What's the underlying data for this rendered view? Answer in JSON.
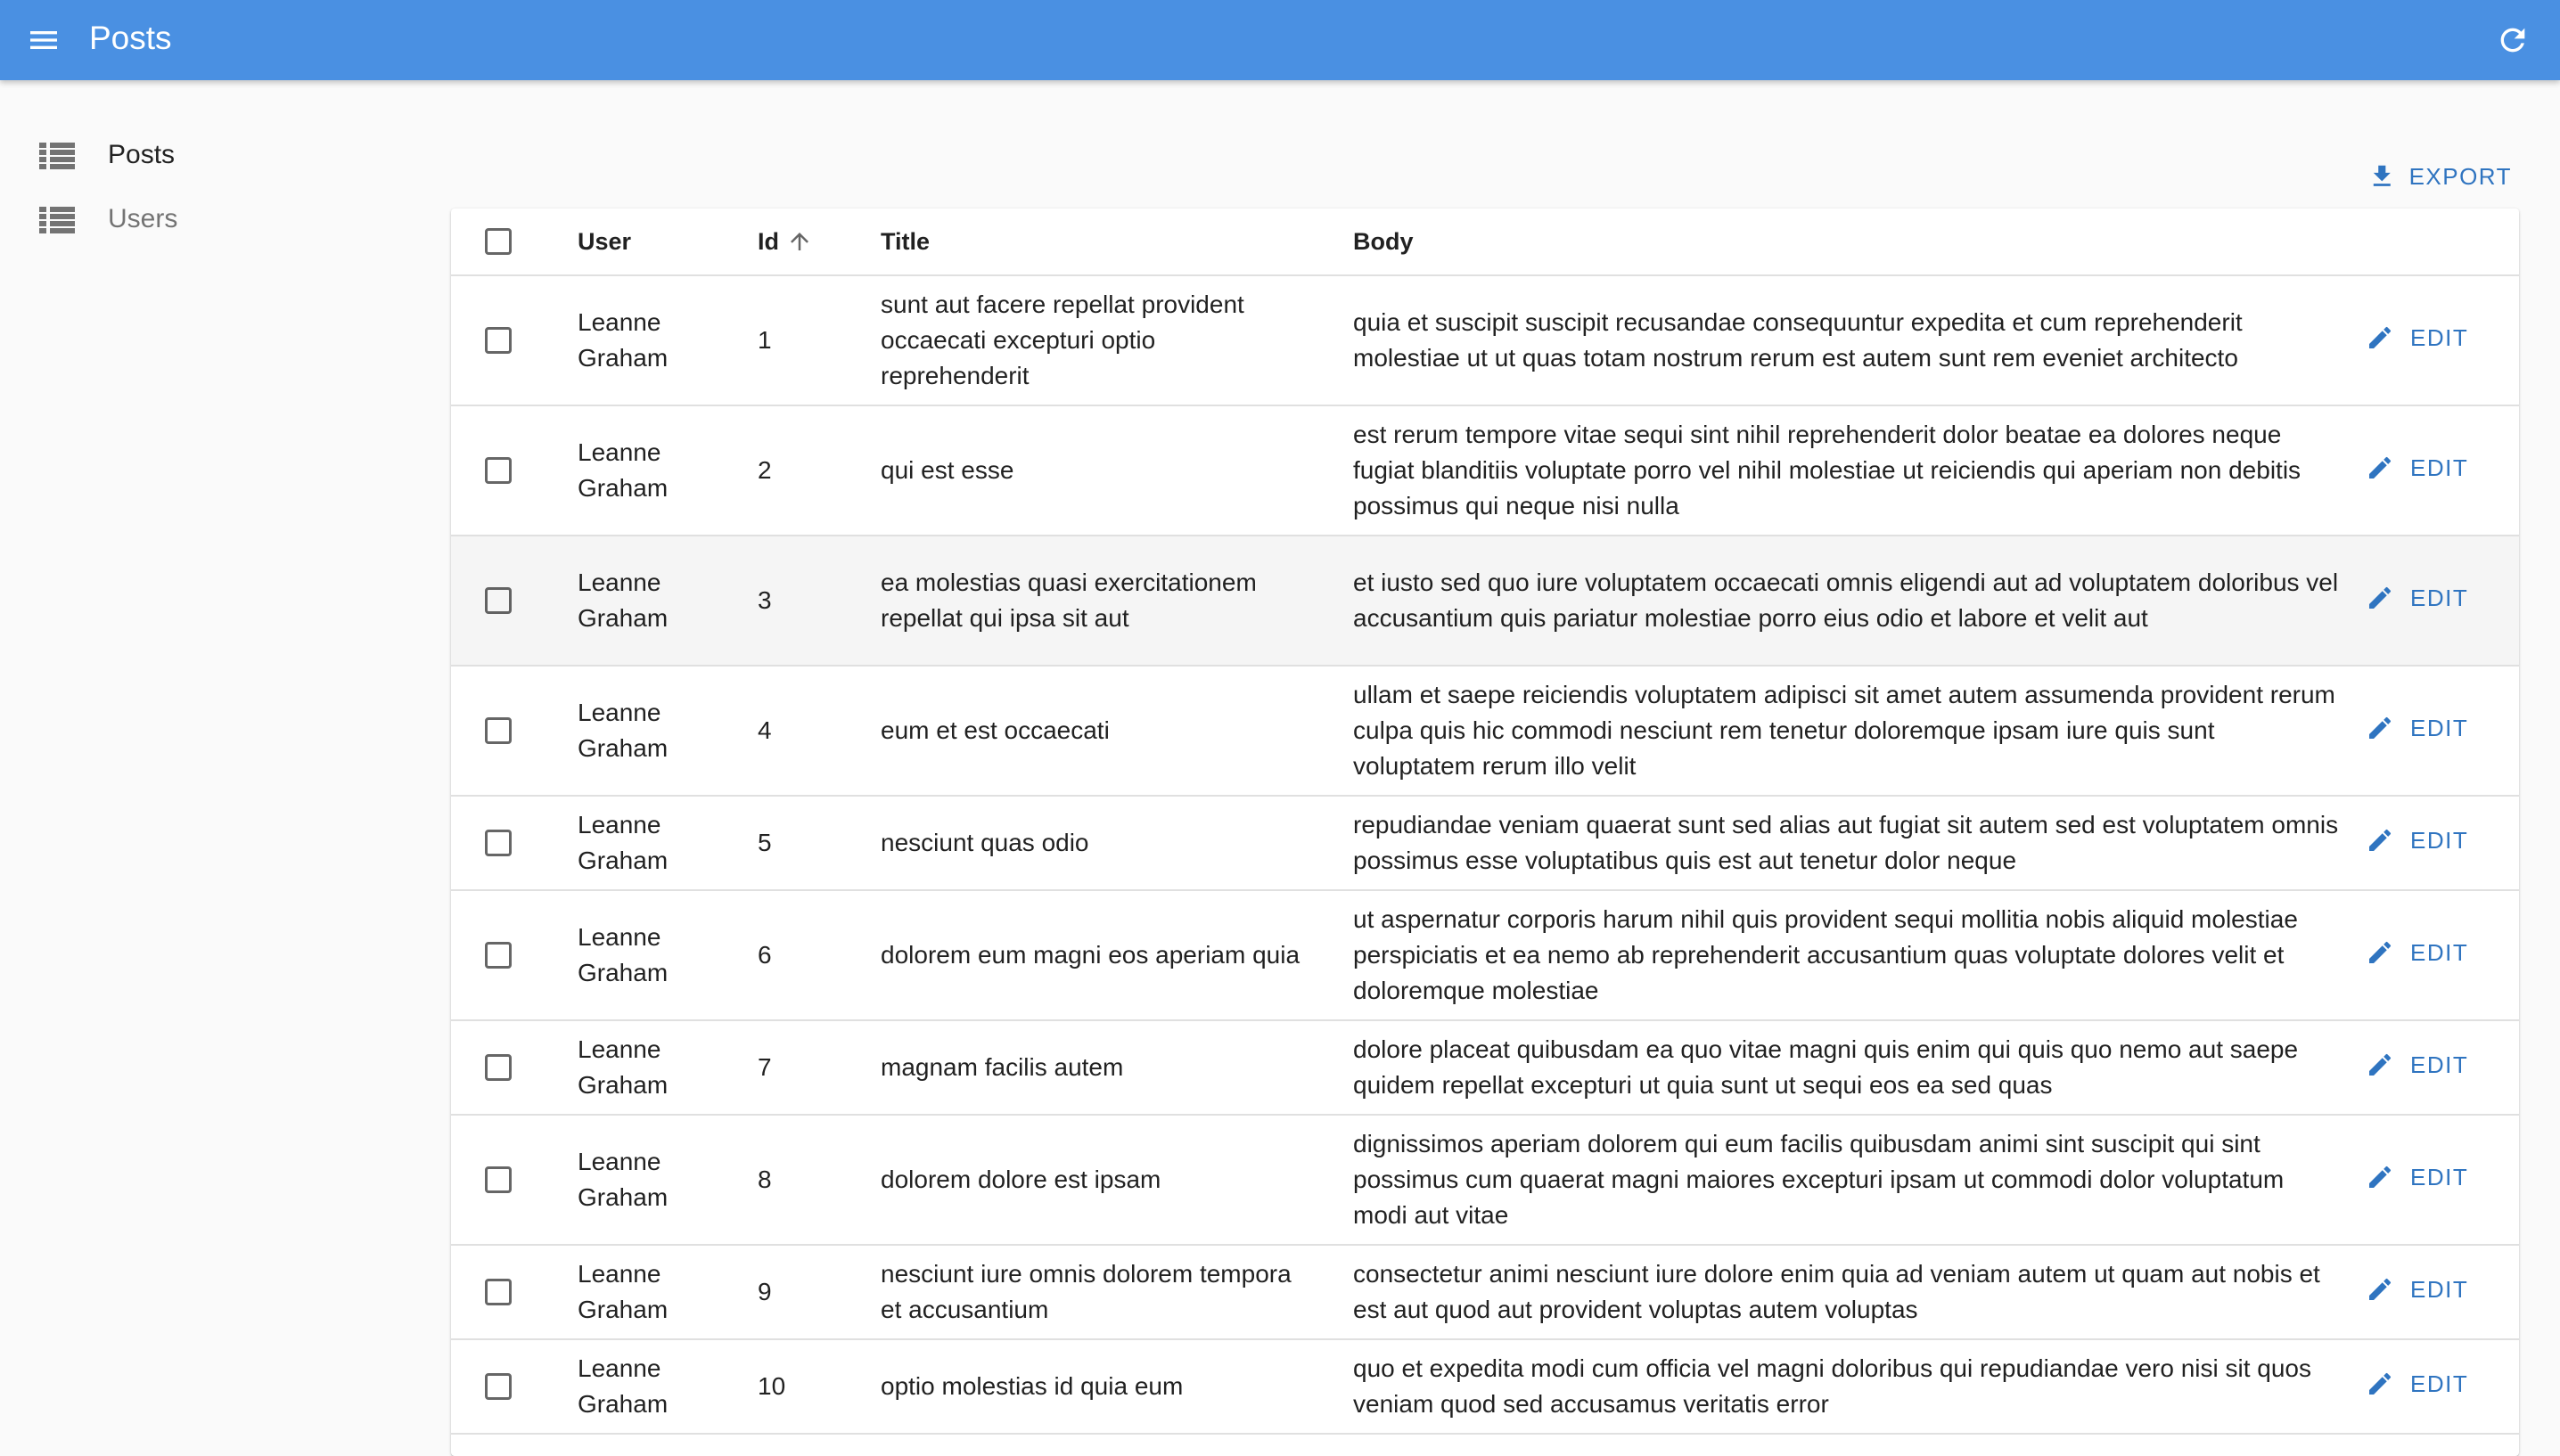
{
  "app": {
    "title": "Posts"
  },
  "sidebar": {
    "items": [
      {
        "label": "Posts",
        "icon": "list-icon",
        "active": true
      },
      {
        "label": "Users",
        "icon": "list-icon",
        "active": false
      }
    ]
  },
  "toolbar": {
    "export_label": "EXPORT"
  },
  "table": {
    "columns": {
      "user": "User",
      "id": "Id",
      "title": "Title",
      "body": "Body"
    },
    "sort": {
      "column": "Id",
      "direction": "ascending"
    },
    "edit_label": "EDIT",
    "rows": [
      {
        "user": "Leanne Graham",
        "id": "1",
        "title": "sunt aut facere repellat provident occaecati excepturi optio reprehenderit",
        "body": "quia et suscipit suscipit recusandae consequuntur expedita et cum reprehenderit molestiae ut ut quas totam nostrum rerum est autem sunt rem eveniet architecto"
      },
      {
        "user": "Leanne Graham",
        "id": "2",
        "title": "qui est esse",
        "body": "est rerum tempore vitae sequi sint nihil reprehenderit dolor beatae ea dolores neque fugiat blanditiis voluptate porro vel nihil molestiae ut reiciendis qui aperiam non debitis possimus qui neque nisi nulla"
      },
      {
        "user": "Leanne Graham",
        "id": "3",
        "title": "ea molestias quasi exercitationem repellat qui ipsa sit aut",
        "body": "et iusto sed quo iure voluptatem occaecati omnis eligendi aut ad voluptatem doloribus vel accusantium quis pariatur molestiae porro eius odio et labore et velit aut"
      },
      {
        "user": "Leanne Graham",
        "id": "4",
        "title": "eum et est occaecati",
        "body": "ullam et saepe reiciendis voluptatem adipisci sit amet autem assumenda provident rerum culpa quis hic commodi nesciunt rem tenetur doloremque ipsam iure quis sunt voluptatem rerum illo velit"
      },
      {
        "user": "Leanne Graham",
        "id": "5",
        "title": "nesciunt quas odio",
        "body": "repudiandae veniam quaerat sunt sed alias aut fugiat sit autem sed est voluptatem omnis possimus esse voluptatibus quis est aut tenetur dolor neque"
      },
      {
        "user": "Leanne Graham",
        "id": "6",
        "title": "dolorem eum magni eos aperiam quia",
        "body": "ut aspernatur corporis harum nihil quis provident sequi mollitia nobis aliquid molestiae perspiciatis et ea nemo ab reprehenderit accusantium quas voluptate dolores velit et doloremque molestiae"
      },
      {
        "user": "Leanne Graham",
        "id": "7",
        "title": "magnam facilis autem",
        "body": "dolore placeat quibusdam ea quo vitae magni quis enim qui quis quo nemo aut saepe quidem repellat excepturi ut quia sunt ut sequi eos ea sed quas"
      },
      {
        "user": "Leanne Graham",
        "id": "8",
        "title": "dolorem dolore est ipsam",
        "body": "dignissimos aperiam dolorem qui eum facilis quibusdam animi sint suscipit qui sint possimus cum quaerat magni maiores excepturi ipsam ut commodi dolor voluptatum modi aut vitae"
      },
      {
        "user": "Leanne Graham",
        "id": "9",
        "title": "nesciunt iure omnis dolorem tempora et accusantium",
        "body": "consectetur animi nesciunt iure dolore enim quia ad veniam autem ut quam aut nobis et est aut quod aut provident voluptas autem voluptas"
      },
      {
        "user": "Leanne Graham",
        "id": "10",
        "title": "optio molestias id quia eum",
        "body": "quo et expedita modi cum officia vel magni doloribus qui repudiandae vero nisi sit quos veniam quod sed accusamus veritatis error"
      }
    ]
  },
  "colors": {
    "appbar": "#4a90e2",
    "accent": "#2f74c0",
    "background": "#fafafa",
    "row_hover": "#f5f5f5"
  }
}
